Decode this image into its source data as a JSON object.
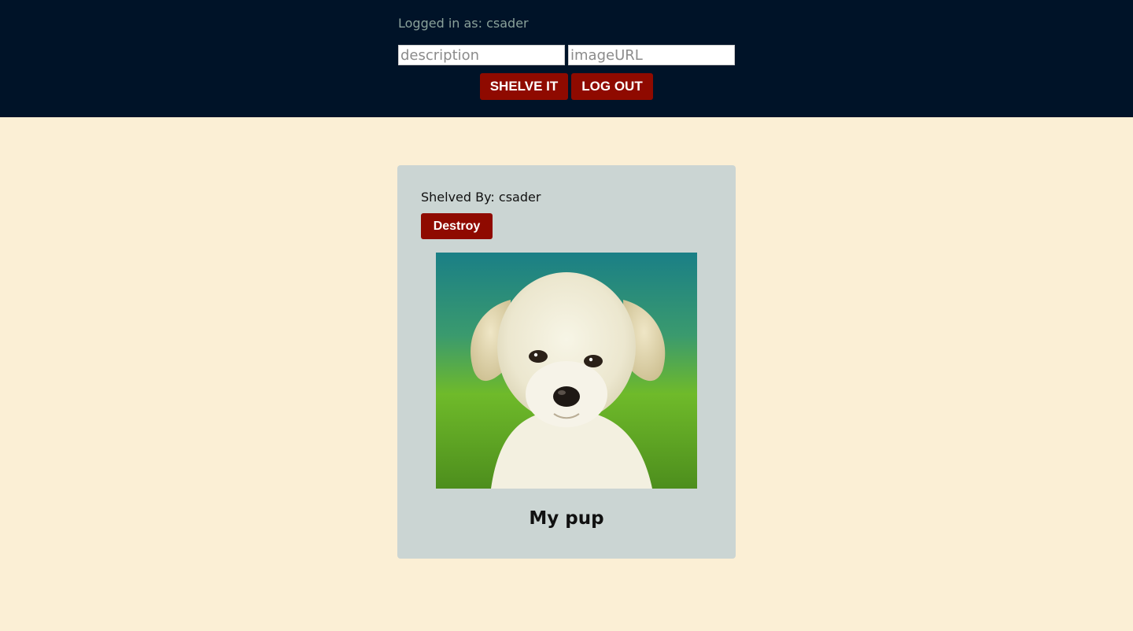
{
  "header": {
    "logged_in_text": "Logged in as: csader",
    "description_placeholder": "description",
    "description_value": "",
    "image_url_placeholder": "imageURL",
    "image_url_value": "",
    "shelve_label": "SHELVE IT",
    "logout_label": "LOG OUT"
  },
  "colors": {
    "header_bg": "#001328",
    "page_bg": "#fbefd5",
    "card_bg": "#cbd5d3",
    "button_bg": "#8f0a00"
  },
  "shelf": {
    "items": [
      {
        "shelved_by": "Shelved By: csader",
        "destroy_label": "Destroy",
        "image_alt": "puppy photo",
        "caption": "My pup"
      }
    ]
  }
}
